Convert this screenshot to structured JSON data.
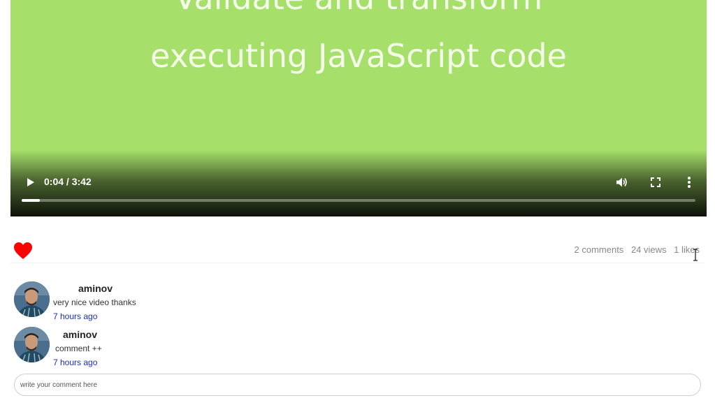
{
  "video": {
    "caption_top": "Validate and transform",
    "caption": "executing JavaScript code",
    "time_display": "0:04 / 3:42",
    "progress": 0.027,
    "bg_color": "#a6e06a",
    "icons": {
      "play": "play-icon",
      "volume": "volume-icon",
      "fullscreen": "fullscreen-icon",
      "more": "more-vertical-icon"
    }
  },
  "stats": {
    "liked": true,
    "heart_color": "#ff0000",
    "comments": "2 comments",
    "views": "24 views",
    "likes": "1 likes"
  },
  "comments": [
    {
      "author": "aminov",
      "text": "very nice video thanks",
      "time": "7 hours ago"
    },
    {
      "author": "aminov",
      "text": "comment ++",
      "time": "7 hours ago"
    }
  ],
  "comment_input": {
    "placeholder": "write your comment here",
    "value": ""
  }
}
